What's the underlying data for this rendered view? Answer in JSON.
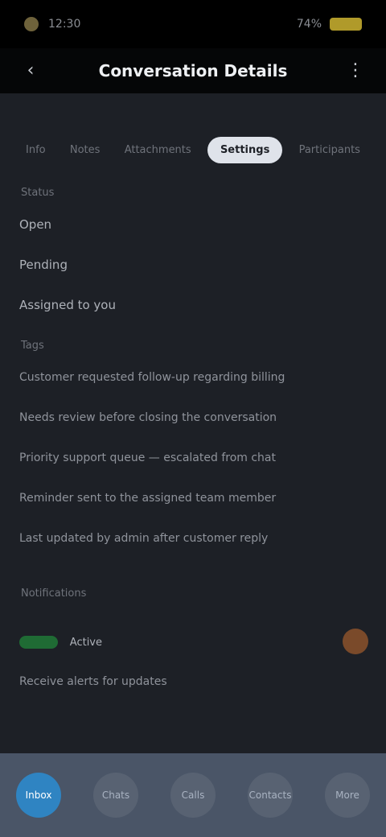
{
  "status": {
    "time": "12:30",
    "battery": "74%"
  },
  "header": {
    "title": "Conversation Details"
  },
  "tabs": [
    {
      "label": "Info"
    },
    {
      "label": "Notes"
    },
    {
      "label": "Attachments"
    },
    {
      "label": "Settings"
    },
    {
      "label": "Participants"
    }
  ],
  "sections": [
    {
      "label": "Status",
      "rows": [
        "Open",
        "Pending",
        "Assigned to you"
      ]
    },
    {
      "label": "Tags",
      "rows": [
        "Customer requested follow-up regarding billing",
        "Needs review before closing the conversation",
        "Priority support queue — escalated from chat",
        "Reminder sent to the assigned team member",
        "Last updated by admin after customer reply"
      ]
    },
    {
      "label": "Notifications",
      "rows": []
    }
  ],
  "extra": {
    "status_text": "Active",
    "summary": "Receive alerts for updates"
  },
  "nav": [
    {
      "label": "Inbox"
    },
    {
      "label": "Chats"
    },
    {
      "label": "Calls"
    },
    {
      "label": "Contacts"
    },
    {
      "label": "More"
    }
  ]
}
